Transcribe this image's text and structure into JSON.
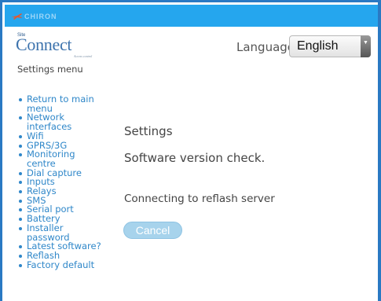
{
  "header": {
    "brand": "CHIRON",
    "logo_small": "Site",
    "logo_main": "Connect",
    "logo_tagline": "Access control"
  },
  "language": {
    "label": "Language:",
    "selected": "English"
  },
  "sidebar": {
    "title": "Settings menu",
    "items": [
      {
        "label": "Return to main menu"
      },
      {
        "label": "Network interfaces"
      },
      {
        "label": "Wifi"
      },
      {
        "label": "GPRS/3G"
      },
      {
        "label": "Monitoring centre"
      },
      {
        "label": "Dial capture"
      },
      {
        "label": "Inputs"
      },
      {
        "label": "Relays"
      },
      {
        "label": "SMS"
      },
      {
        "label": "Serial port"
      },
      {
        "label": "Battery"
      },
      {
        "label": "Installer password"
      },
      {
        "label": "Latest software?"
      },
      {
        "label": "Reflash"
      },
      {
        "label": "Factory default"
      }
    ]
  },
  "main": {
    "heading": "Settings",
    "subheading": "Software version check.",
    "status": "Connecting to reflash server",
    "cancel_label": "Cancel"
  },
  "colors": {
    "topbar": "#25a6ee",
    "frame": "#2a79c3",
    "link": "#2f87c9",
    "button": "#a7d3ec"
  }
}
